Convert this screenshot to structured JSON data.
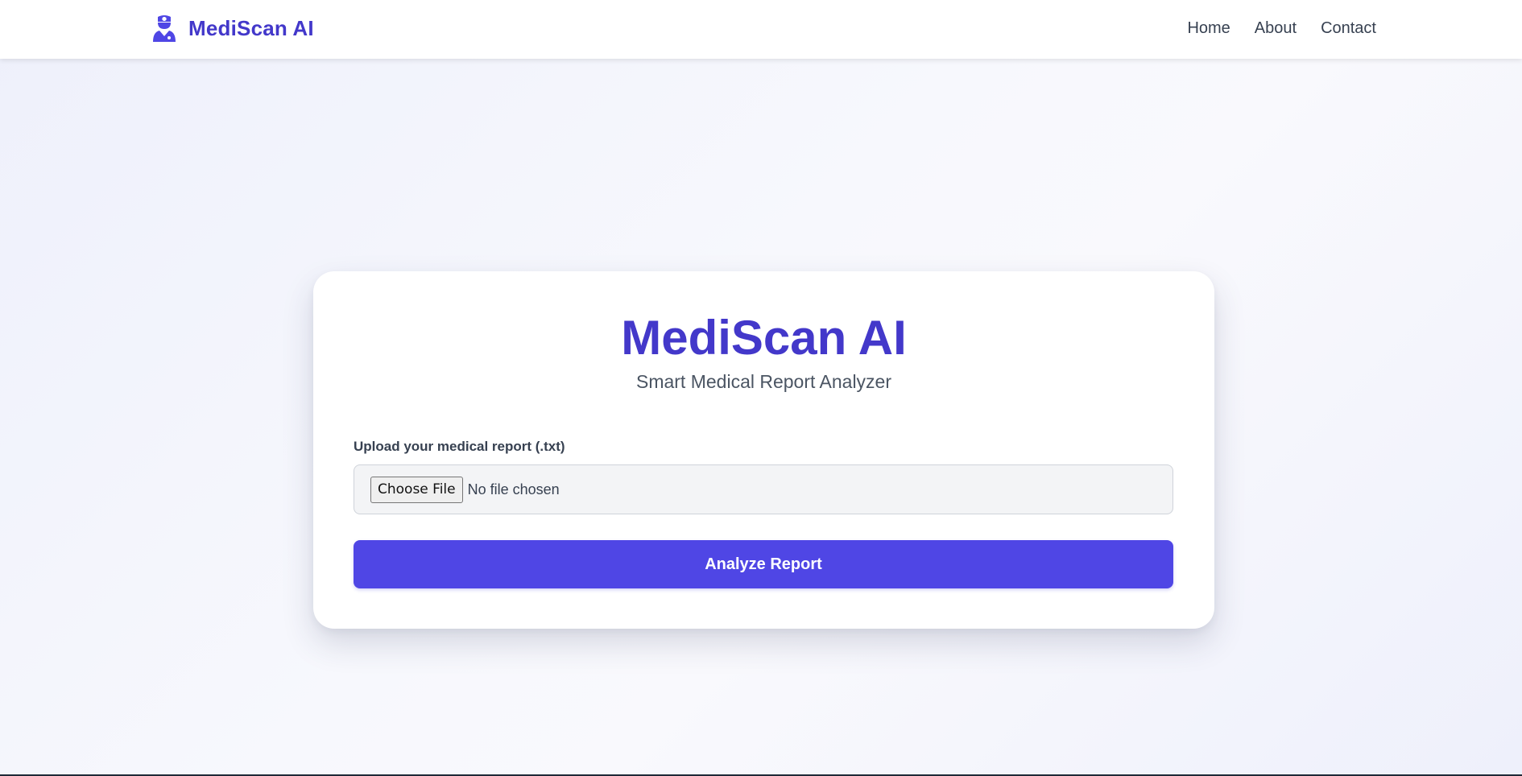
{
  "navbar": {
    "brand_name": "MediScan AI",
    "brand_icon": "doctor-icon",
    "links": [
      "Home",
      "About",
      "Contact"
    ]
  },
  "card": {
    "title": "MediScan AI",
    "subtitle": "Smart Medical Report Analyzer",
    "upload_label": "Upload your medical report (.txt)",
    "file_input": {
      "button_label": "Choose File",
      "status": "No file chosen"
    },
    "submit_label": "Analyze Report"
  },
  "colors": {
    "brand": "#4338ca",
    "button": "#4f46e5"
  }
}
